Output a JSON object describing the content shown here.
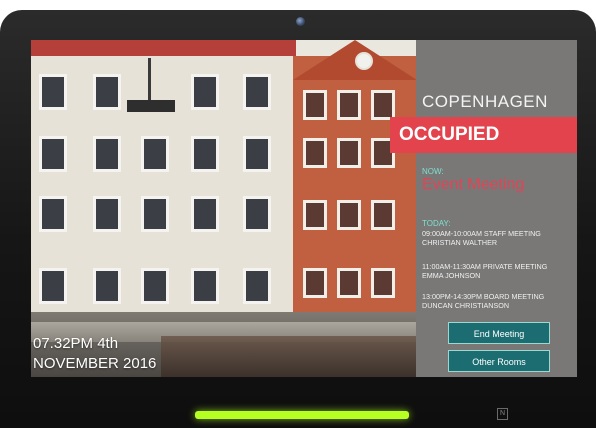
{
  "photo": {
    "description_label": "Copenhagen street photo"
  },
  "overlay": {
    "time": "07.32PM 4th",
    "date": "NOVEMBER 2016"
  },
  "room": {
    "name": "COPENHAGEN",
    "status": "OCCUPIED",
    "status_color": "#e2434d",
    "now_label": "NOW:",
    "now_event": "Event Meeting",
    "today_label": "TODAY:",
    "schedule": [
      {
        "line1": "09:00AM-10:00AM STAFF MEETING",
        "line2": "CHRISTIAN WALTHER"
      },
      {
        "line1": "11:00AM-11:30AM PRIVATE MEETING",
        "line2": "EMMA JOHNSON"
      },
      {
        "line1": "13:00PM-14:30PM BOARD MEETING",
        "line2": "DUNCAN CHRISTIANSON"
      }
    ]
  },
  "buttons": {
    "end_meeting": "End Meeting",
    "other_rooms": "Other Rooms"
  },
  "device": {
    "led_color": "#b5ff23",
    "nfc_symbol": "N"
  }
}
